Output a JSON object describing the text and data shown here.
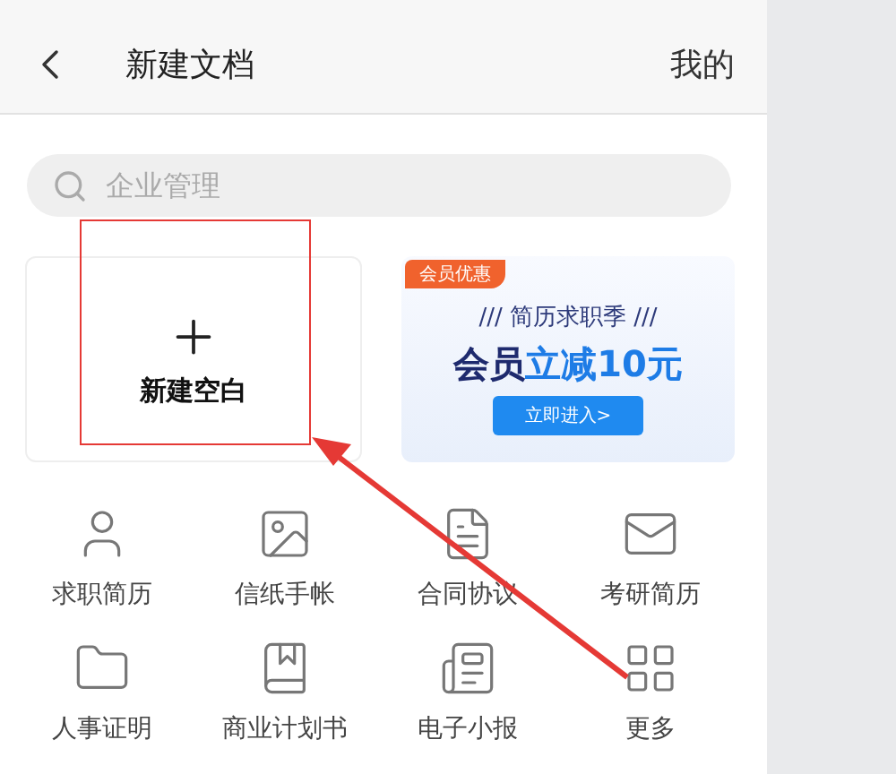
{
  "header": {
    "title": "新建文档",
    "right_link": "我的"
  },
  "search": {
    "placeholder": "企业管理"
  },
  "new_blank": {
    "label": "新建空白"
  },
  "banner": {
    "badge": "会员优惠",
    "slogan": "/// 简历求职季 ///",
    "headline": "会员**立减10元**",
    "button": "立即进入>"
  },
  "templates": [
    {
      "label": "求职简历"
    },
    {
      "label": "信纸手帐"
    },
    {
      "label": "合同协议"
    },
    {
      "label": "考研简历"
    },
    {
      "label": "人事证明"
    },
    {
      "label": "商业计划书"
    },
    {
      "label": "电子小报"
    },
    {
      "label": "更多"
    }
  ]
}
